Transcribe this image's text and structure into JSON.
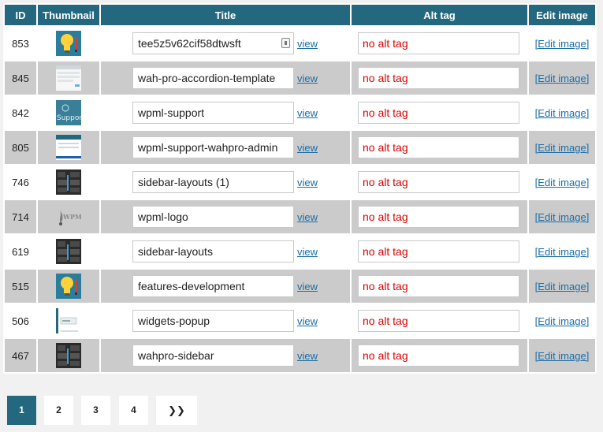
{
  "table": {
    "headers": {
      "id": "ID",
      "thumbnail": "Thumbnail",
      "title": "Title",
      "alt": "Alt tag",
      "edit": "Edit image"
    },
    "rows": [
      {
        "id": "853",
        "title": "tee5z5v62cif58dtwsft",
        "view": "view",
        "alt": "no alt tag",
        "edit": "[Edit image]",
        "thumb": "lightbulb-thumbnail"
      },
      {
        "id": "845",
        "title": "wah-pro-accordion-template",
        "view": "view",
        "alt": "no alt tag",
        "edit": "[Edit image]",
        "thumb": "webpage-thumbnail"
      },
      {
        "id": "842",
        "title": "wpml-support",
        "view": "view",
        "alt": "no alt tag",
        "edit": "[Edit image]",
        "thumb": "support-thumbnail"
      },
      {
        "id": "805",
        "title": "wpml-support-wahpro-admin",
        "view": "view",
        "alt": "no alt tag",
        "edit": "[Edit image]",
        "thumb": "admin-screen-thumbnail"
      },
      {
        "id": "746",
        "title": "sidebar-layouts (1)",
        "view": "view",
        "alt": "no alt tag",
        "edit": "[Edit image]",
        "thumb": "dark-layout-thumbnail"
      },
      {
        "id": "714",
        "title": "wpml-logo",
        "view": "view",
        "alt": "no alt tag",
        "edit": "[Edit image]",
        "thumb": "wpml-logo-thumbnail",
        "thumb_text": "WPML"
      },
      {
        "id": "619",
        "title": "sidebar-layouts",
        "view": "view",
        "alt": "no alt tag",
        "edit": "[Edit image]",
        "thumb": "dark-layout-thumbnail"
      },
      {
        "id": "515",
        "title": "features-development",
        "view": "view",
        "alt": "no alt tag",
        "edit": "[Edit image]",
        "thumb": "lightbulb-thumbnail"
      },
      {
        "id": "506",
        "title": "widgets-popup",
        "view": "view",
        "alt": "no alt tag",
        "edit": "[Edit image]",
        "thumb": "popup-thumbnail"
      },
      {
        "id": "467",
        "title": "wahpro-sidebar",
        "view": "view",
        "alt": "no alt tag",
        "edit": "[Edit image]",
        "thumb": "dark-layout-thumbnail"
      }
    ],
    "support_thumb_text": "Support"
  },
  "pagination": {
    "pages": [
      "1",
      "2",
      "3",
      "4"
    ],
    "current": "1",
    "next": "❯❯"
  },
  "colors": {
    "header_bg": "#23687e",
    "row_alt_bg": "#cbcbcb",
    "alt_text": "#e00000",
    "link": "#1a6ea8"
  }
}
